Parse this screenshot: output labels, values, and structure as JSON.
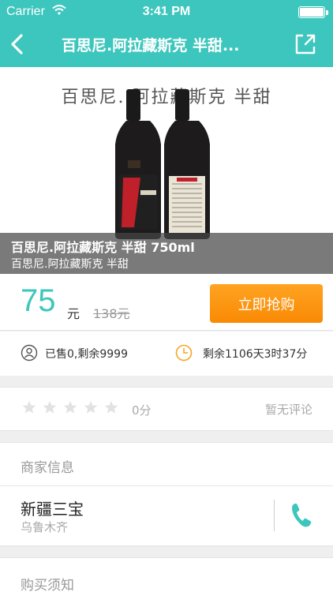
{
  "status_bar": {
    "carrier": "Carrier",
    "time": "3:41 PM",
    "battery_level": 1.0
  },
  "nav": {
    "title": "百思尼.阿拉藏斯克 半甜...",
    "back_icon": "chevron-left-icon",
    "share_icon": "share-icon"
  },
  "hero": {
    "image_text": "百思尼. 阿拉藏斯克  半甜",
    "overlay_line1": "百思尼.阿拉藏斯克 半甜 750ml",
    "overlay_line2": "百思尼.阿拉藏斯克 半甜"
  },
  "price": {
    "current": "75",
    "unit": "元",
    "original": "138元",
    "buy_label": "立即抢购"
  },
  "stats": {
    "sold_text": "已售0,剩余9999",
    "remaining_text": "剩余1106天3时37分"
  },
  "rating": {
    "stars_filled": 0,
    "stars_total": 5,
    "score": "0分",
    "comment_status": "暂无评论"
  },
  "merchant": {
    "header": "商家信息",
    "name": "新疆三宝",
    "city": "乌鲁木齐"
  },
  "notice": {
    "header": "购买须知"
  },
  "colors": {
    "brand": "#3dc6bd",
    "buy_button": "#f98a05",
    "clock_icon": "#f5a623"
  }
}
